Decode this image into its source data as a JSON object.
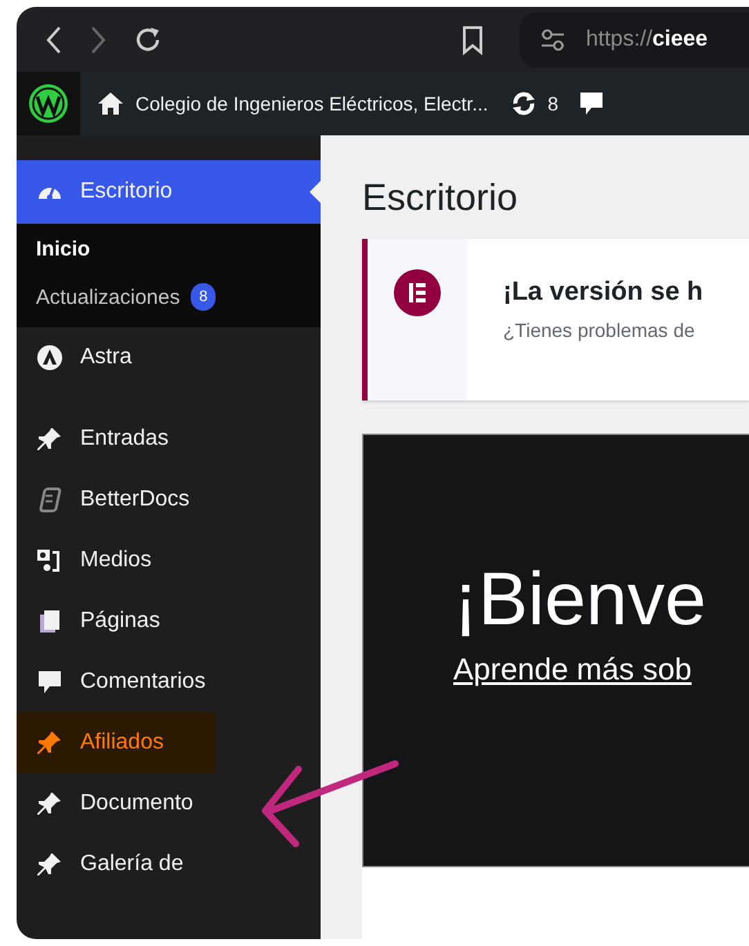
{
  "browser": {
    "back_disabled": false,
    "forward_disabled": true,
    "url_scheme": "https://",
    "url_host": "cieee"
  },
  "admin_bar": {
    "site_title": "Colegio de Ingenieros Eléctricos, Electr...",
    "updates": "8"
  },
  "sidebar": {
    "items": [
      {
        "label": "Escritorio",
        "selected": true,
        "highlighted": false,
        "children": [
          {
            "label": "Inicio",
            "selected": true
          },
          {
            "label": "Actualizaciones",
            "selected": false,
            "badge": "8"
          }
        ]
      },
      {
        "label": "Astra",
        "selected": false,
        "highlighted": false
      },
      {
        "label": "Entradas",
        "selected": false,
        "highlighted": false
      },
      {
        "label": "BetterDocs",
        "selected": false,
        "highlighted": false
      },
      {
        "label": "Medios",
        "selected": false,
        "highlighted": false
      },
      {
        "label": "Páginas",
        "selected": false,
        "highlighted": false
      },
      {
        "label": "Comentarios",
        "selected": false,
        "highlighted": false
      },
      {
        "label": "Afiliados",
        "selected": false,
        "highlighted": true
      },
      {
        "label": "Documento",
        "selected": false,
        "highlighted": false
      },
      {
        "label": "Galería de",
        "selected": false,
        "highlighted": false
      }
    ]
  },
  "main": {
    "title": "Escritorio",
    "notice": {
      "title": "¡La versión se h",
      "text": "¿Tienes problemas de"
    },
    "welcome": {
      "heading": "¡Bienve",
      "link": "Aprende más sob"
    }
  }
}
